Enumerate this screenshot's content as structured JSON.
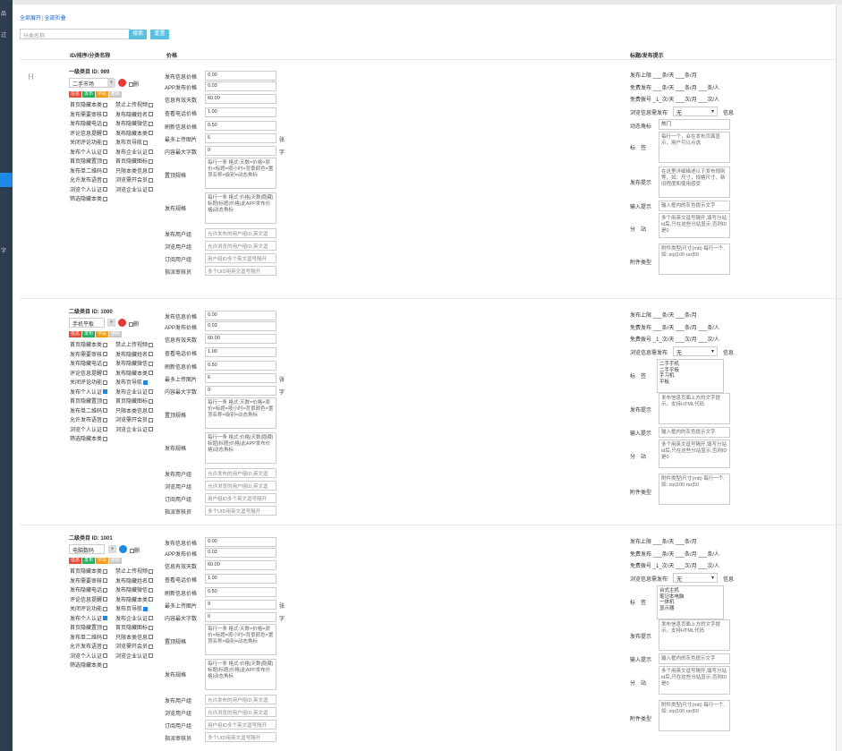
{
  "sidebar": {
    "glyphs": [
      "品",
      "过",
      "字"
    ]
  },
  "toolbar": {
    "expand_all": "全部展开",
    "collapse_all": "全部折叠",
    "search_placeholder": "分类名称",
    "search_btn": "搜索",
    "reset_btn": "重置"
  },
  "headers": {
    "col1": "ID/排序/分类名称",
    "col2": "价格",
    "col3": "标题/发布提示"
  },
  "expand_toggle": "[-]",
  "common": {
    "tags": [
      "信息",
      "发布",
      "字段",
      "删除"
    ],
    "del_label": "删",
    "price_labels": [
      "发布信息价格",
      "APP发布价格",
      "信息有效天数",
      "查看电话价格",
      "刷新信息价格",
      "最多上传图片",
      "内容最大字数",
      "置顶规格",
      "发布规格",
      "发布用户组",
      "浏览用户组",
      "订阅用户组",
      "指派审核员"
    ],
    "unit_image": "张",
    "unit_chars": "字",
    "pinned_spec": "每行一条 格式:天数=价格=原价=标题=按小时=背景颜色=置顶名称=级别=动态角标",
    "publish_spec": "每行一条 格式:价格|天数|隐藏|标题|标题|价格|此APP发布价格|动态角标",
    "pub_group": "允许发布的用户组ID,英文逗",
    "view_group": "允许浏览的用户组ID,英文逗",
    "sub_group": "用户组ID多个英文逗号隔开",
    "reviewer": "多个UID用英文逗号隔开",
    "r_pub": {
      "pre": "发布上限",
      "a": "条/天",
      "b": "条/月"
    },
    "r_free": {
      "pre": "免费发布",
      "a": "条/天",
      "b": "条/月",
      "c": "条/人"
    },
    "r_refresh": {
      "pre": "免费拨号",
      "a": "次/天",
      "b": "次/月",
      "c": "次/人"
    },
    "r_view": {
      "pre": "浏览信息需发布",
      "val": "无",
      "suf": "信息"
    },
    "r_labels": {
      "badge": "动态角标",
      "tag": "标　签",
      "tip": "发布提示",
      "input": "输入提示",
      "site": "分　站",
      "attach": "附件类型"
    },
    "input_tip": "输入框内的灰色提示文字",
    "site_tip": "多个用英文逗号隔开,填写分站id后,只在这些分站显示,否则ID是0",
    "attach_tip": "附件类型|尺寸(mb) 每行一个,如: zip|100 rar|50"
  },
  "blocks": [
    {
      "title": "一级类目 ID: 999",
      "name": "二手市场",
      "prices": [
        "0.00",
        "0.03",
        "60.00",
        "1.00",
        "0.50",
        "6",
        "0"
      ],
      "checks": [
        [
          "首页隐藏本类",
          false,
          "禁止上传视频",
          false
        ],
        [
          "发布需要审核",
          false,
          "发布隐藏姓名",
          false
        ],
        [
          "发布隐藏电话",
          false,
          "发布隐藏微信",
          false
        ],
        [
          "评论信息提醒",
          false,
          "发布隐藏本类",
          false
        ],
        [
          "关闭评论功能",
          false,
          "发布页导航",
          false
        ],
        [
          "发布个人认证",
          false,
          "发布企业认证",
          false
        ],
        [
          "首页隐藏置顶",
          false,
          "首页隐藏图标",
          false
        ],
        [
          "发布单二维码",
          false,
          "只限本类信息",
          false
        ],
        [
          "允许发布语音",
          false,
          "浏览需开会员",
          false
        ],
        [
          "浏览个人认证",
          false,
          "浏览企业认证",
          false
        ],
        [
          "筛选隐藏本类",
          false,
          "",
          false
        ]
      ],
      "r_badge": "热门",
      "r_tag_ta": "每行一个，会在发布页面显示，用户可以点选",
      "r_tip_ta": "在这里详细描述以下发布规则等，如：尺寸，规格尺寸，新旧程度和使用感受"
    },
    {
      "title": "二级类目 ID: 1000",
      "name": "手机平板",
      "prices": [
        "0.00",
        "0.03",
        "60.00",
        "1.00",
        "0.50",
        "6",
        "0"
      ],
      "checks": [
        [
          "首页隐藏本类",
          false,
          "禁止上传视频",
          false
        ],
        [
          "发布需要审核",
          false,
          "发布隐藏姓名",
          false
        ],
        [
          "发布隐藏电话",
          false,
          "发布隐藏微信",
          false
        ],
        [
          "评论信息提醒",
          false,
          "发布隐藏本类",
          false
        ],
        [
          "关闭评论功能",
          false,
          "发布页导航",
          true
        ],
        [
          "发布个人认证",
          true,
          "发布企业认证",
          false
        ],
        [
          "首页隐藏置顶",
          false,
          "首页隐藏图标",
          false
        ],
        [
          "发布单二维码",
          false,
          "只限本类信息",
          false
        ],
        [
          "允许发布语音",
          false,
          "浏览需开会员",
          false
        ],
        [
          "浏览个人认证",
          false,
          "浏览企业认证",
          false
        ],
        [
          "筛选隐藏本类",
          false,
          "",
          false
        ]
      ],
      "r_list": [
        "二手手机",
        "二手平板",
        "手习机",
        "平板"
      ],
      "r_tip_ta": "发布信息页面上方的文字提示。支持HTML代码"
    },
    {
      "title": "二级类目 ID: 1001",
      "name": "电脑数码",
      "prices": [
        "0.00",
        "0.03",
        "60.00",
        "1.00",
        "0.50",
        "9",
        "0"
      ],
      "checks": [
        [
          "首页隐藏本类",
          false,
          "禁止上传视频",
          false
        ],
        [
          "发布需要审核",
          false,
          "发布隐藏姓名",
          false
        ],
        [
          "发布隐藏电话",
          false,
          "发布隐藏微信",
          false
        ],
        [
          "评论信息提醒",
          false,
          "发布隐藏本类",
          false
        ],
        [
          "关闭评论功能",
          false,
          "发布页导航",
          true
        ],
        [
          "发布个人认证",
          true,
          "发布企业认证",
          false
        ],
        [
          "首页隐藏置顶",
          false,
          "首页隐藏图标",
          false
        ],
        [
          "发布单二维码",
          false,
          "只限本类信息",
          false
        ],
        [
          "允许发布语音",
          false,
          "浏览需开会员",
          false
        ],
        [
          "浏览个人认证",
          false,
          "浏览企业认证",
          false
        ],
        [
          "筛选隐藏本类",
          false,
          "",
          false
        ]
      ],
      "r_list": [
        "台式主机",
        "笔记本电脑",
        "一体机",
        "显示器"
      ],
      "r_tip_ta": "发布信息页面上方的文字提示。支持HTML代码"
    }
  ]
}
